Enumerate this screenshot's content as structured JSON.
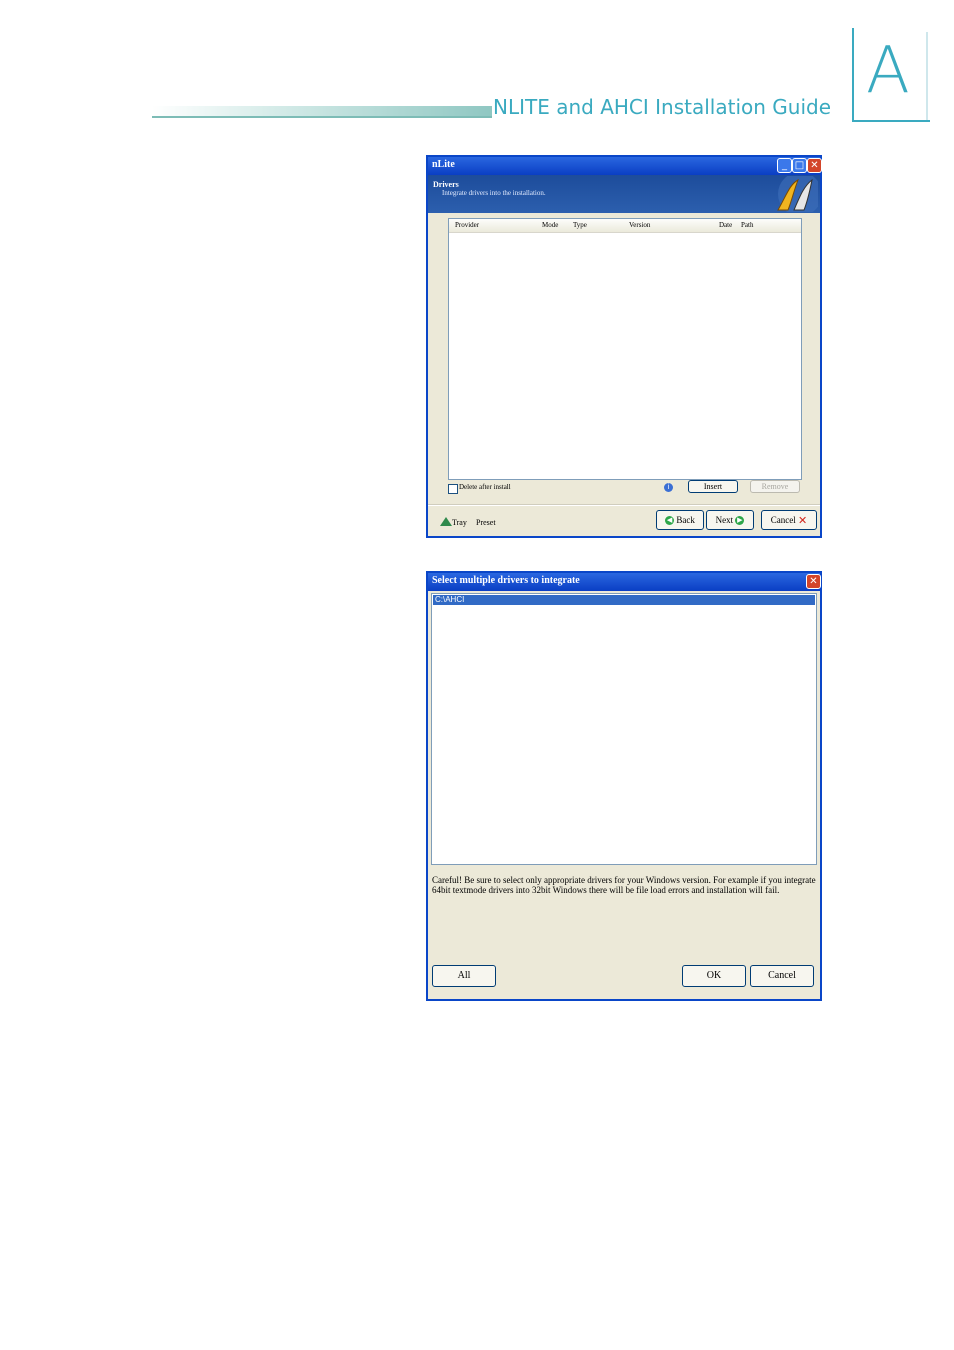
{
  "page": {
    "section_title": "NLITE and AHCI Installation Guide",
    "appendix_letter": "A"
  },
  "window1": {
    "title": "nLite",
    "header_title": "Drivers",
    "header_subtitle": "Integrate drivers into the installation.",
    "columns": [
      "Provider",
      "Mode",
      "Type",
      "Version",
      "Date",
      "Path"
    ],
    "delete_after_install_label": "Delete after install",
    "delete_after_install_checked": false,
    "insert_label": "Insert",
    "remove_label": "Remove",
    "tray_label": "Tray",
    "preset_label": "Preset",
    "back_label": "Back",
    "next_label": "Next",
    "cancel_label": "Cancel",
    "icons": {
      "minimize": "minimize-icon",
      "maximize": "maximize-icon",
      "close": "close-icon",
      "info": "info-icon",
      "back": "arrow-left-icon",
      "next": "arrow-right-icon",
      "cancel": "x-icon",
      "tray": "tray-icon"
    },
    "colors": {
      "titlebar": "#0a3ec4",
      "header": "#1d4c9b",
      "face": "#ece9d8"
    }
  },
  "window2": {
    "title": "Select multiple drivers to integrate",
    "items": [
      "C:\\AHCI"
    ],
    "selected_item": "C:\\AHCI",
    "warning": "Careful! Be sure to select only appropriate drivers for your Windows version. For example if you integrate 64bit textmode drivers into 32bit Windows there will be file load errors and installation will fail.",
    "all_label": "All",
    "ok_label": "OK",
    "cancel_label": "Cancel",
    "colors": {
      "selection": "#316ac5"
    }
  }
}
